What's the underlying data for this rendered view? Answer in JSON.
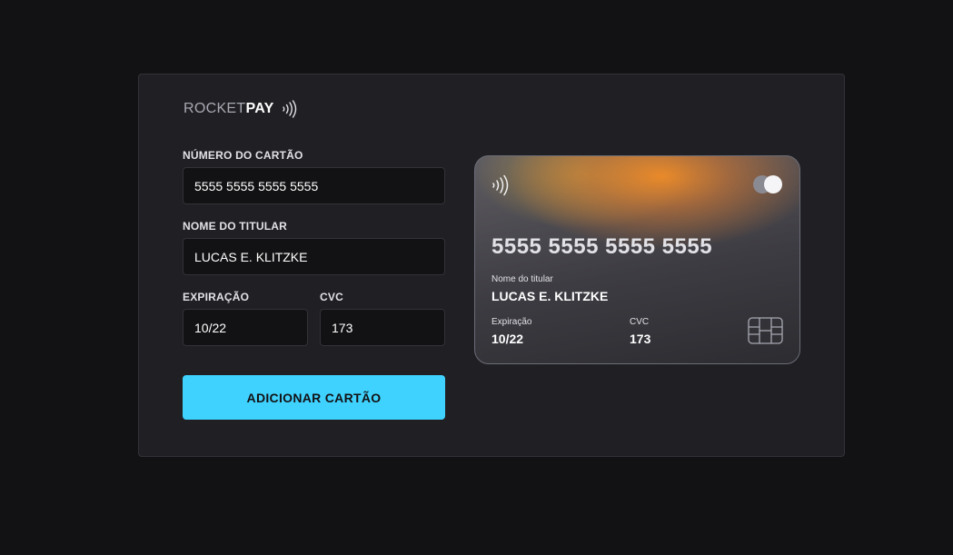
{
  "logo": {
    "part1": "ROCKET",
    "part2": "PAY"
  },
  "form": {
    "card_number_label": "NÚMERO DO CARTÃO",
    "card_number_value": "5555 5555 5555 5555",
    "holder_label": "NOME DO TITULAR",
    "holder_value": "LUCAS E. KLITZKE",
    "expiration_label": "EXPIRAÇÃO",
    "expiration_value": "10/22",
    "cvc_label": "CVC",
    "cvc_value": "173",
    "submit_label": "ADICIONAR CARTÃO"
  },
  "card": {
    "number": "5555 5555 5555 5555",
    "holder_label": "Nome do titular",
    "holder": "LUCAS E. KLITZKE",
    "expiration_label": "Expiração",
    "expiration": "10/22",
    "cvc_label": "CVC",
    "cvc": "173",
    "brand_icon": "mastercard-icon",
    "chip_icon": "chip-icon"
  },
  "colors": {
    "background": "#121214",
    "panel": "#202024",
    "accent": "#3fd2ff"
  }
}
